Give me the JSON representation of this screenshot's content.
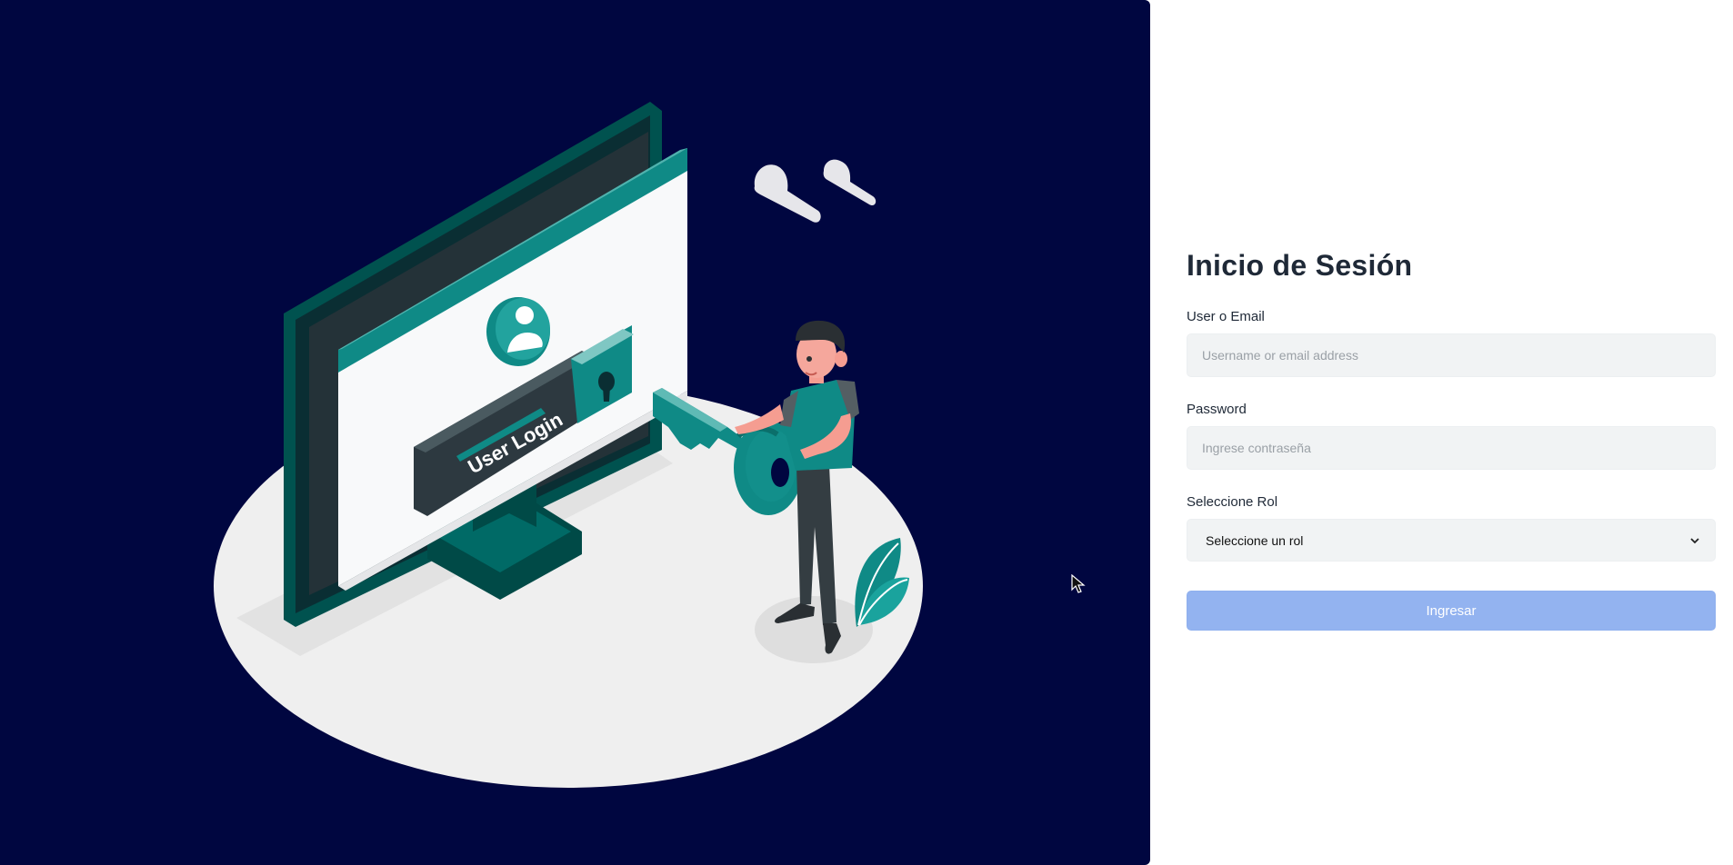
{
  "login": {
    "title": "Inicio de Sesión",
    "user_label": "User o Email",
    "user_placeholder": "Username or email address",
    "password_label": "Password",
    "password_placeholder": "Ingrese contraseña",
    "role_label": "Seleccione Rol",
    "role_selected": "Seleccione un rol",
    "submit_label": "Ingresar"
  },
  "illustration": {
    "screen_text": "User Login"
  },
  "colors": {
    "hero_background": "#000640",
    "accent_teal": "#0f8a86",
    "button_background": "#93b3f0",
    "input_background": "#f1f3f4",
    "title_text": "#1f2937"
  }
}
